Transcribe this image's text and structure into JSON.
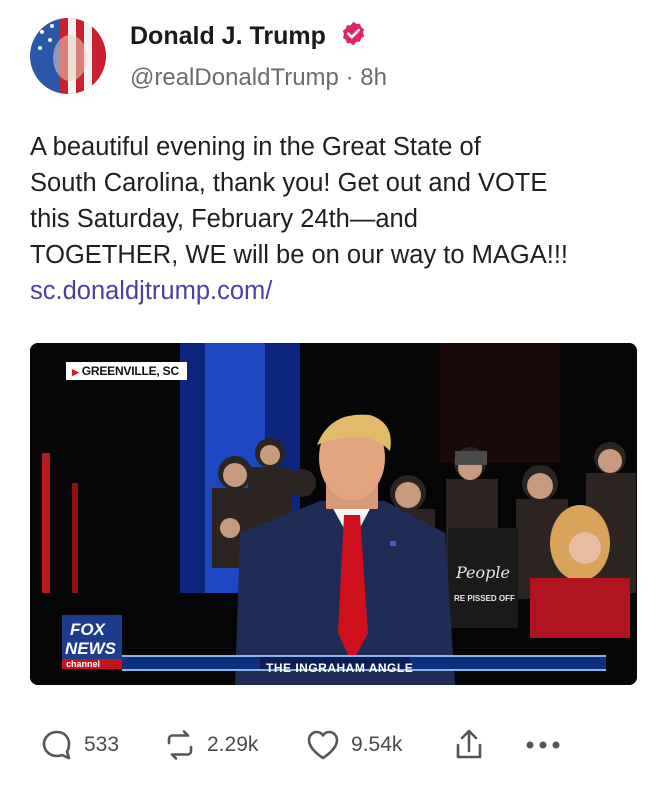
{
  "author": {
    "display_name": "Donald J. Trump",
    "handle": "@realDonaldTrump",
    "separator": "·",
    "time_ago": "8h",
    "verified_icon": "verified-badge-icon",
    "verified_color": "#e0245e"
  },
  "post": {
    "lines": [
      "A beautiful evening in the Great State of",
      "South Carolina, thank you! Get out and VOTE",
      "this Saturday, February 24th—and",
      "TOGETHER, WE will be on our way to MAGA!!!"
    ],
    "link_text": "sc.donaldjtrump.com/",
    "link_color": "#4b3fa8"
  },
  "media": {
    "location_badge": "GREENVILLE, SC",
    "network_logo": {
      "line1": "FOX",
      "line2": "NEWS",
      "line3": "channel"
    },
    "show_title": "THE INGRAHAM ANGLE",
    "shirt_text_1": "People",
    "shirt_text_2": "RE PISSED OFF"
  },
  "actions": {
    "replies": "533",
    "reposts": "2.29k",
    "likes": "9.54k",
    "share_icon": "share-icon",
    "more_icon": "more-icon"
  }
}
